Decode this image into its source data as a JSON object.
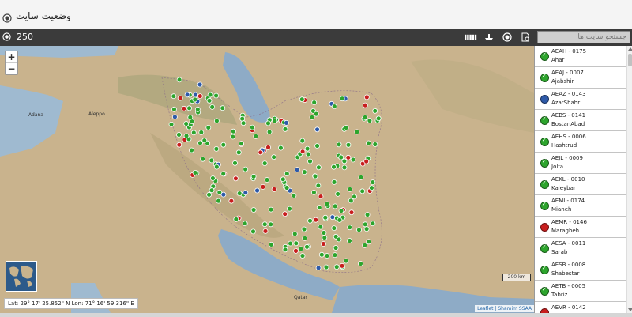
{
  "header": {
    "title": "وضعیت سایت"
  },
  "toolbar": {
    "count": "250",
    "search_placeholder": "جستجو سایت ها",
    "icons": [
      "radio-icon",
      "signal-bars-icon",
      "ship-icon",
      "target-icon",
      "refresh-page-icon"
    ]
  },
  "map": {
    "zoom_in": "+",
    "zoom_out": "−",
    "coordinates": "Lat: 29° 17' 25.852\" N Lon: 71° 16' 59.316\" E",
    "scale_label": "200 km",
    "attribution": "Leaflet | Shamim SSAA",
    "status_colors": {
      "ok": "#2da52d",
      "alarm": "#c81e1e",
      "warning": "#2e5aa8"
    },
    "map_labels": [
      "Adana",
      "Aleppo",
      "Qatar"
    ]
  },
  "sites": [
    {
      "code": "AEAH - 0175",
      "name": "Ahar",
      "status": "ok"
    },
    {
      "code": "AEAJ - 0007",
      "name": "Ajabshir",
      "status": "ok"
    },
    {
      "code": "AEAZ - 0143",
      "name": "AzarShahr",
      "status": "warning"
    },
    {
      "code": "AEBS - 0141",
      "name": "BostanAbad",
      "status": "ok"
    },
    {
      "code": "AEHS - 0006",
      "name": "Hashtrud",
      "status": "ok"
    },
    {
      "code": "AEJL - 0009",
      "name": "Jolfa",
      "status": "ok"
    },
    {
      "code": "AEKL - 0010",
      "name": "Kaleybar",
      "status": "ok"
    },
    {
      "code": "AEMI - 0174",
      "name": "Mianeh",
      "status": "ok"
    },
    {
      "code": "AEMR - 0146",
      "name": "Maragheh",
      "status": "alarm"
    },
    {
      "code": "AESA - 0011",
      "name": "Sarab",
      "status": "ok"
    },
    {
      "code": "AESB - 0008",
      "name": "Shabestar",
      "status": "ok"
    },
    {
      "code": "AETB - 0005",
      "name": "Tabriz",
      "status": "ok"
    },
    {
      "code": "AEVR - 0142",
      "name": "",
      "status": "alarm"
    }
  ]
}
